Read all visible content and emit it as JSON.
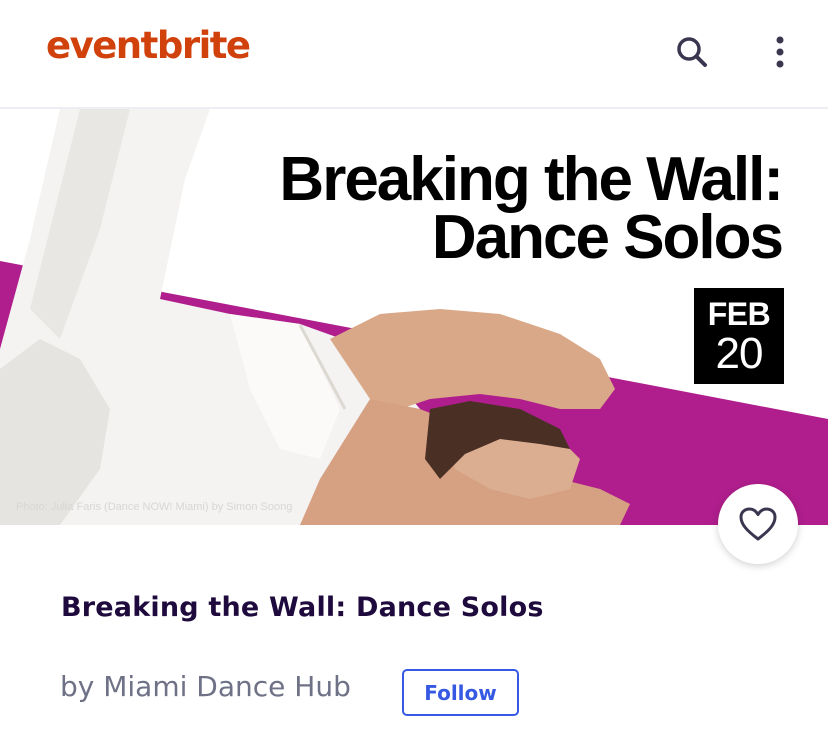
{
  "header": {
    "logo_text": "eventbrite",
    "brand_color": "#d1410c",
    "icons": [
      "search-icon",
      "more-vertical-icon"
    ]
  },
  "hero": {
    "title_line1": "Breaking the Wall:",
    "title_line2": "Dance Solos",
    "date_month": "FEB",
    "date_day": "20",
    "photo_credit": "Photo: Julia Faris (Dance NOW! Miami) by Simon Soong",
    "accent_color": "#b01e8d"
  },
  "event": {
    "title": "Breaking the Wall: Dance Solos",
    "organizer": "by Miami Dance Hub",
    "follow_label": "Follow",
    "like_icon": "heart-icon"
  }
}
